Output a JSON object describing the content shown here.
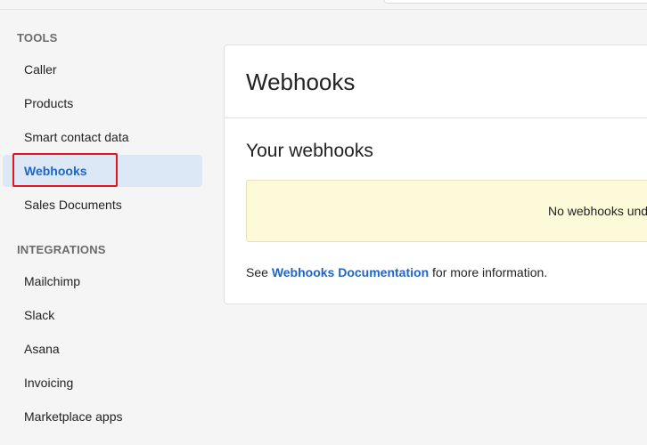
{
  "sidebar": {
    "sections": [
      {
        "title": "TOOLS",
        "items": [
          {
            "label": "Caller",
            "active": false
          },
          {
            "label": "Products",
            "active": false
          },
          {
            "label": "Smart contact data",
            "active": false
          },
          {
            "label": "Webhooks",
            "active": true
          },
          {
            "label": "Sales Documents",
            "active": false
          }
        ]
      },
      {
        "title": "INTEGRATIONS",
        "items": [
          {
            "label": "Mailchimp",
            "active": false
          },
          {
            "label": "Slack",
            "active": false
          },
          {
            "label": "Asana",
            "active": false
          },
          {
            "label": "Invoicing",
            "active": false
          },
          {
            "label": "Marketplace apps",
            "active": false
          }
        ]
      }
    ]
  },
  "main": {
    "title": "Webhooks",
    "section_title": "Your webhooks",
    "empty_message": "No webhooks und",
    "info": {
      "prefix": "See ",
      "link_label": "Webhooks Documentation",
      "suffix": " for more information."
    }
  },
  "colors": {
    "accent": "#1f65c6",
    "active_bg": "#dde8f7",
    "highlight": "#e3141b",
    "empty_bg": "#fdfad9"
  }
}
